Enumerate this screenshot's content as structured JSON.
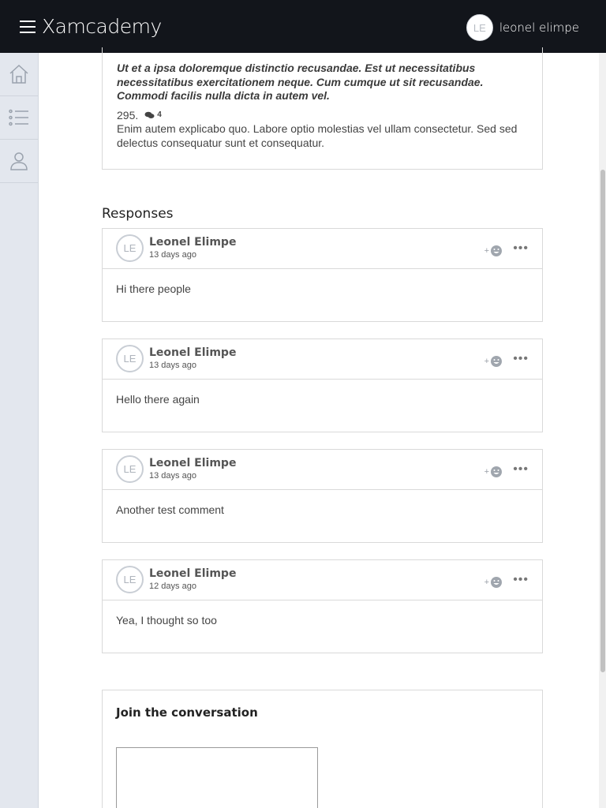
{
  "header": {
    "brand": "Xamcademy",
    "user_initials": "LE",
    "user_name": "leonel elimpe"
  },
  "sidebar": {
    "items": [
      {
        "icon": "home-icon"
      },
      {
        "icon": "list-icon"
      },
      {
        "icon": "user-icon"
      }
    ]
  },
  "question": {
    "text": "Ut et a ipsa doloremque distinctio recusandae. Est ut necessitatibus necessitatibus exercitationem neque. Cum cumque ut sit recusandae. Commodi facilis nulla dicta in autem vel.",
    "number": "295.",
    "comment_count": "4",
    "body": "Enim autem explicabo quo. Labore optio molestias vel ullam consectetur. Sed sed delectus consequatur sunt et consequatur."
  },
  "responses_title": "Responses",
  "responses": [
    {
      "initials": "LE",
      "author": "Leonel Elimpe",
      "time": "13 days ago",
      "body": "Hi there people",
      "react_label": "+",
      "more_label": "•••"
    },
    {
      "initials": "LE",
      "author": "Leonel Elimpe",
      "time": "13 days ago",
      "body": "Hello there again",
      "react_label": "+",
      "more_label": "•••"
    },
    {
      "initials": "LE",
      "author": "Leonel Elimpe",
      "time": "13 days ago",
      "body": "Another test comment",
      "react_label": "+",
      "more_label": "•••"
    },
    {
      "initials": "LE",
      "author": "Leonel Elimpe",
      "time": "12 days ago",
      "body": "Yea, I thought so too",
      "react_label": "+",
      "more_label": "•••"
    }
  ],
  "join": {
    "title": "Join the conversation"
  }
}
